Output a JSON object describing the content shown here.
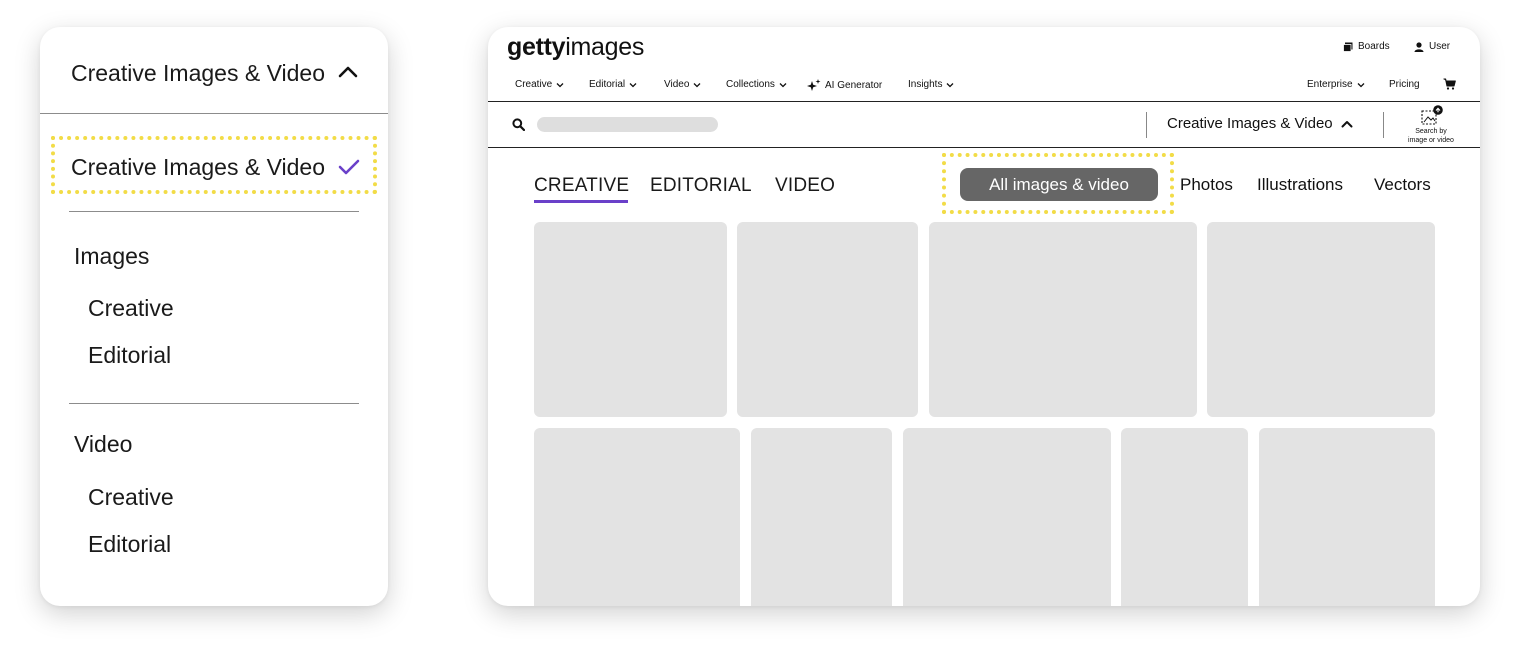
{
  "dropdown": {
    "header_label": "Creative Images & Video",
    "selected_label": "Creative Images & Video",
    "groups": [
      {
        "label": "Images",
        "items": [
          {
            "label": "Creative"
          },
          {
            "label": "Editorial"
          }
        ]
      },
      {
        "label": "Video",
        "items": [
          {
            "label": "Creative"
          },
          {
            "label": "Editorial"
          }
        ]
      }
    ],
    "highlight_color": "#f2dc47",
    "check_color": "#6a40c9"
  },
  "site": {
    "logo_bold": "getty",
    "logo_light": "images",
    "util": {
      "boards": "Boards",
      "user": "User"
    },
    "nav": {
      "creative": "Creative",
      "editorial": "Editorial",
      "video": "Video",
      "collections": "Collections",
      "ai_generator": "AI Generator",
      "insights": "Insights",
      "enterprise": "Enterprise",
      "pricing": "Pricing"
    },
    "search": {
      "placeholder": "",
      "type_label": "Creative Images & Video",
      "by_image_line1": "Search by",
      "by_image_line2": "image or video"
    },
    "tabs": {
      "creative": "CREATIVE",
      "editorial": "EDITORIAL",
      "video": "VIDEO",
      "active": "CREATIVE"
    },
    "filters": {
      "all": "All images & video",
      "photos": "Photos",
      "illustrations": "Illustrations",
      "vectors": "Vectors"
    },
    "accent_color": "#6a40c9",
    "pill_color": "#666666",
    "placeholder_tile_color": "#e3e3e3"
  }
}
